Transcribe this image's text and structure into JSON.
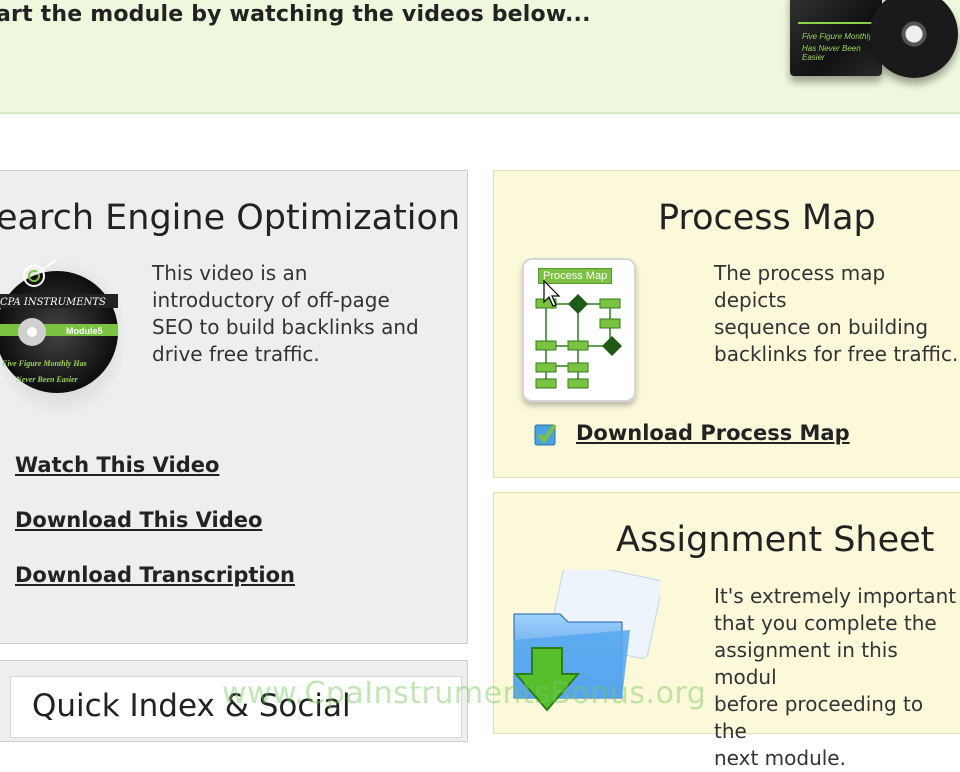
{
  "banner": {
    "text": "art the module by watching the videos below...",
    "box_tagline_1": "Five Figure Monthly",
    "box_tagline_2": "Has Never Been Easier"
  },
  "seo": {
    "title": "earch Engine Optimization",
    "description": "This video is an\nintroductory of off-page\nSEO to build backlinks and\ndrive free traffic.",
    "disc_brand": "CPA INSTRUMENTS",
    "disc_module": "Module5",
    "disc_tagline_1": "Five Figure Monthly Has",
    "disc_tagline_2": "Never Been Easier",
    "links": {
      "watch": "Watch This Video",
      "download_video": "Download This Video",
      "download_transcription": "Download Transcription"
    }
  },
  "quick_index": {
    "title": "Quick Index & Social"
  },
  "process_map": {
    "title": "Process Map",
    "thumb_label": "Process Map",
    "description": "The process map depicts\nsequence on building\nbacklinks for free traffic.",
    "download_label": "Download Process Map"
  },
  "assignment": {
    "title": "Assignment Sheet",
    "description": "It's extremely important\nthat you complete the\nassignment in this modul\nbefore proceeding to the\nnext module."
  },
  "watermark": "www.CpaInstrumentsBonus.org",
  "colors": {
    "banner_bg": "#eef8dc",
    "gray_panel": "#eeeeee",
    "yellow_panel": "#fcf9db",
    "accent_green": "#7cc242"
  }
}
